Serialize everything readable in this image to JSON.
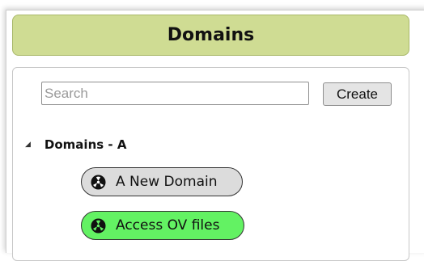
{
  "header": {
    "title": "Domains"
  },
  "search": {
    "placeholder": "Search"
  },
  "toolbar": {
    "create_label": "Create"
  },
  "tree": {
    "group_label": "Domains - A",
    "expanded": true,
    "items": [
      {
        "label": "A New Domain",
        "color": "#dcdcdc",
        "icon": "radiation-icon"
      },
      {
        "label": "Access OV files",
        "color": "#63f263",
        "icon": "radiation-icon"
      }
    ]
  }
}
